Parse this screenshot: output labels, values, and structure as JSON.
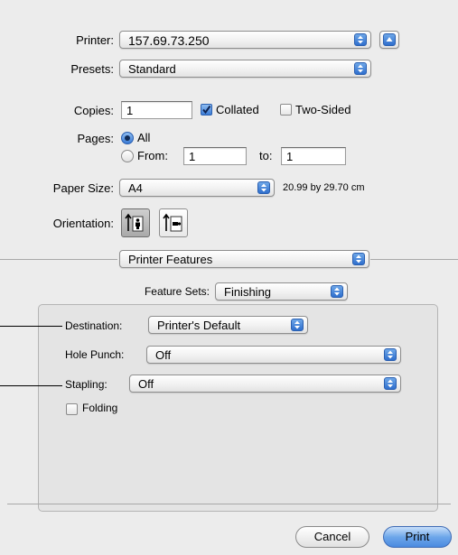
{
  "printer": {
    "label": "Printer:",
    "value": "157.69.73.250"
  },
  "presets": {
    "label": "Presets:",
    "value": "Standard"
  },
  "copies": {
    "label": "Copies:",
    "value": "1",
    "collated_label": "Collated",
    "collated": true,
    "two_sided_label": "Two-Sided",
    "two_sided": false
  },
  "pages": {
    "label": "Pages:",
    "all_label": "All",
    "from_label": "From:",
    "from_value": "1",
    "to_label": "to:",
    "to_value": "1",
    "selected": "all"
  },
  "paper_size": {
    "label": "Paper Size:",
    "value": "A4",
    "dimensions": "20.99 by 29.70 cm"
  },
  "orientation": {
    "label": "Orientation:",
    "selected": "portrait"
  },
  "panel": {
    "value": "Printer Features"
  },
  "feature_sets": {
    "label": "Feature Sets:",
    "value": "Finishing"
  },
  "destination": {
    "label": "Destination:",
    "value": "Printer's Default"
  },
  "hole_punch": {
    "label": "Hole Punch:",
    "value": "Off"
  },
  "stapling": {
    "label": "Stapling:",
    "value": "Off"
  },
  "folding": {
    "label": "Folding",
    "checked": false
  },
  "buttons": {
    "cancel": "Cancel",
    "print": "Print"
  },
  "colors": {
    "accent": "#3a7bd5",
    "background": "#ececec"
  }
}
